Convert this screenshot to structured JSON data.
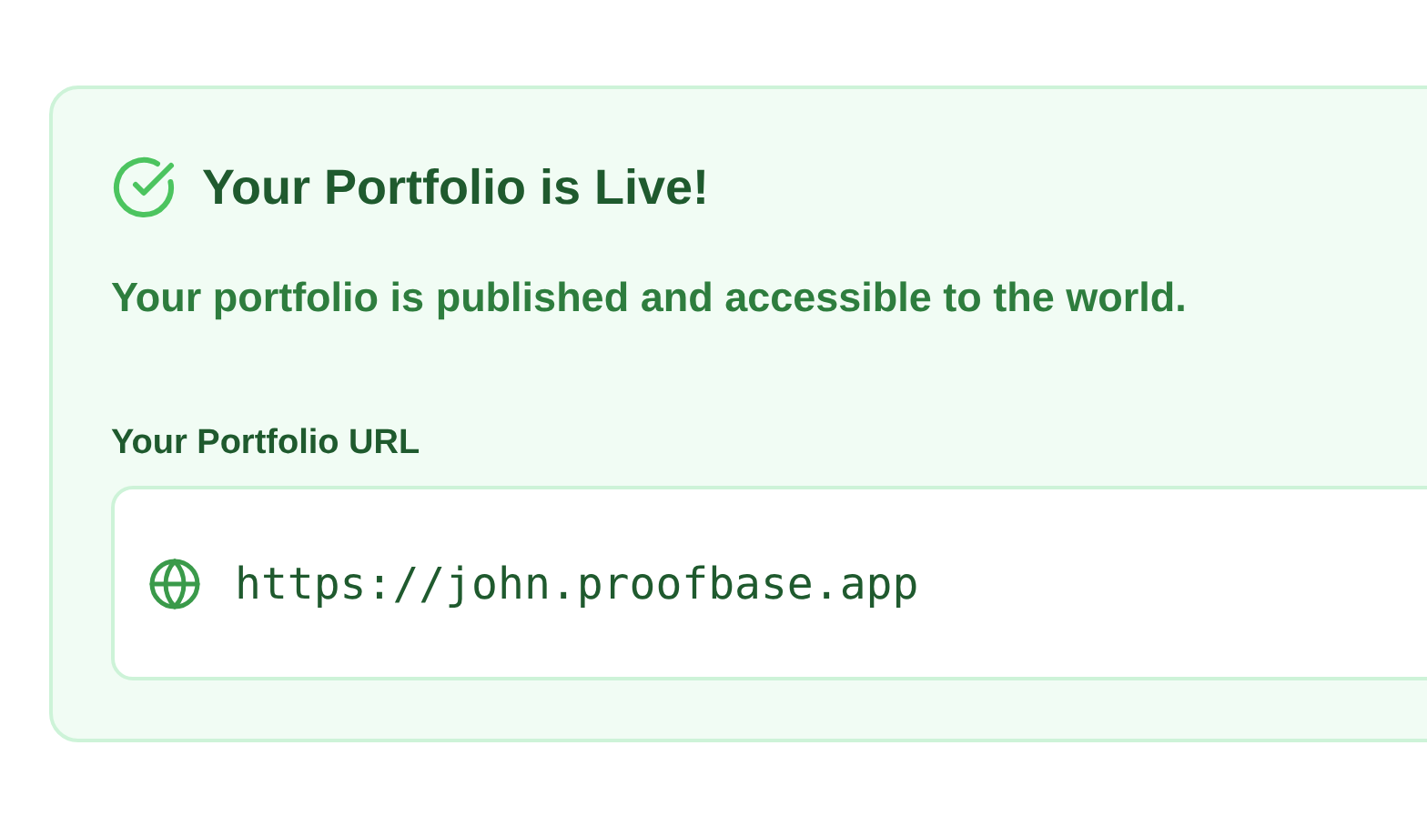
{
  "card": {
    "title": "Your Portfolio is Live!",
    "description": "Your portfolio is published and accessible to the world.",
    "url_label": "Your Portfolio URL",
    "url": "https://john.proofbase.app"
  }
}
